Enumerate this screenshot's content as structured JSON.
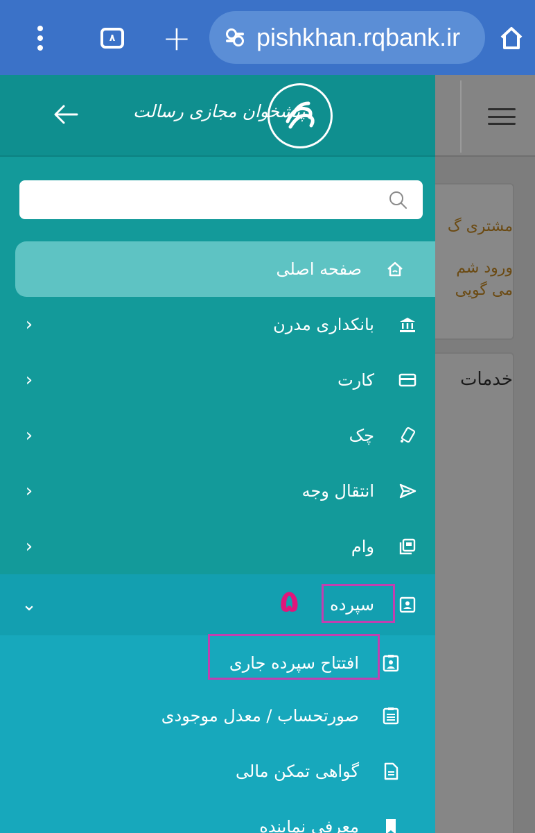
{
  "browser": {
    "tab_count": "٨",
    "url": "pishkhan.rqbank.ir"
  },
  "background_page": {
    "card1_line1": "مشتری گ",
    "card1_line2": "ورود شم",
    "card1_line3": "می گویی",
    "card2_title": "خدمات"
  },
  "drawer": {
    "logo_text": "پیشخوان مجازی رسالت",
    "search_placeholder": "",
    "menu": {
      "home": "صفحه اصلی",
      "modern_banking": "بانکداری مدرن",
      "card": "کارت",
      "cheque": "چک",
      "transfer": "انتقال وجه",
      "loan": "وام",
      "deposit": "سپرده"
    },
    "deposit_submenu": {
      "open_current": "افتتاح سپرده جاری",
      "statement": "صورتحساب / معدل موجودی",
      "financial_cert": "گواهی تمکن مالی",
      "representative": "معرفی نماینده"
    },
    "annotation_step": "۵"
  },
  "colors": {
    "chrome": "#3b72c8",
    "drawer": "#139a9a",
    "deposit_section": "#17a8bc",
    "highlight": "#c23fb0",
    "step_number": "#e0157b"
  }
}
